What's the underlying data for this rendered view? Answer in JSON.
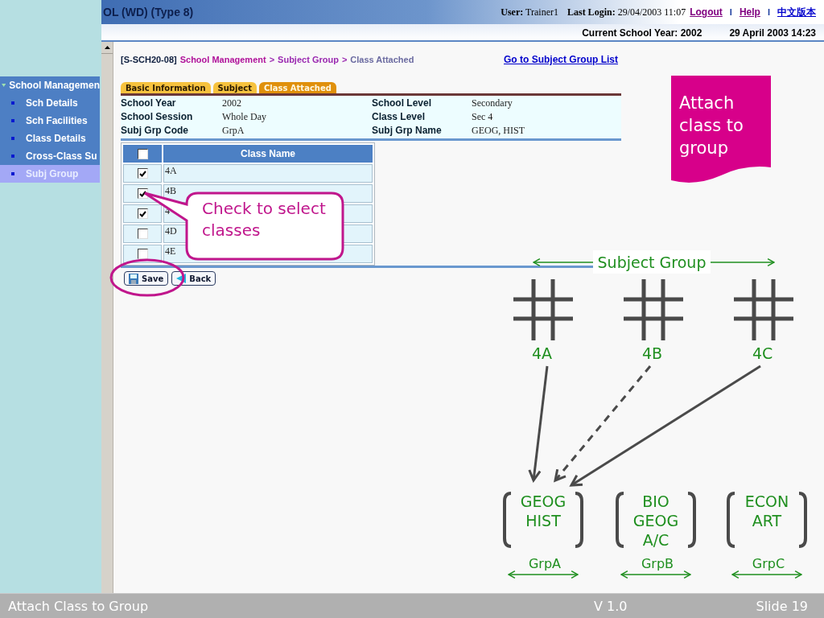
{
  "header": {
    "title": "OL (WD) (Type 8)",
    "user_label": "User:",
    "user": "Trainer1",
    "last_login_label": "Last Login:",
    "last_login": "29/04/2003 11:07",
    "links": [
      {
        "label": "Logout",
        "kind": "visited"
      },
      {
        "label": "Help",
        "kind": "visited"
      },
      {
        "label": "中文版本",
        "kind": "plain"
      }
    ],
    "separators": [
      "I",
      "I"
    ],
    "current_school_year": "Current School Year: 2002",
    "datetime": "29 April 2003 14:23"
  },
  "sidebar": {
    "items": [
      {
        "label": "School Managemen",
        "kind": "heading",
        "selected": false
      },
      {
        "label": "Sch Details",
        "kind": "item",
        "selected": false
      },
      {
        "label": "Sch Facilities",
        "kind": "item",
        "selected": false
      },
      {
        "label": "Class Details",
        "kind": "item",
        "selected": false
      },
      {
        "label": "Cross-Class Su",
        "kind": "item",
        "selected": false
      },
      {
        "label": "Subj Group",
        "kind": "item",
        "selected": true
      }
    ]
  },
  "breadcrumb": [
    {
      "text": "[S-SCH20-08]",
      "kind": "code"
    },
    {
      "text": "School Management",
      "kind": "link"
    },
    {
      "text": ">",
      "kind": "sep"
    },
    {
      "text": "Subject Group",
      "kind": "link2"
    },
    {
      "text": ">",
      "kind": "sep"
    },
    {
      "text": "Class Attached",
      "kind": "current"
    }
  ],
  "go_to_link": "Go to Subject Group List",
  "tabs": [
    {
      "label": "Basic Information",
      "selected": false
    },
    {
      "label": "Subject",
      "selected": false
    },
    {
      "label": "Class Attached",
      "selected": true
    }
  ],
  "fields": [
    {
      "label": "School Year",
      "value": "2002"
    },
    {
      "label": "School Level",
      "value": "Secondary"
    },
    {
      "label": "School Session",
      "value": "Whole Day"
    },
    {
      "label": "Class Level",
      "value": "Sec 4"
    },
    {
      "label": "Subj Grp Code",
      "value": "GrpA"
    },
    {
      "label": "Subj Grp Name",
      "value": "GEOG, HIST"
    }
  ],
  "class_table": {
    "select_all_checked": false,
    "column": "Class Name",
    "rows": [
      {
        "name": "4A",
        "checked": true
      },
      {
        "name": "4B",
        "checked": true
      },
      {
        "name": "4",
        "checked": true
      },
      {
        "name": "4D",
        "checked": false
      },
      {
        "name": "4E",
        "checked": false
      }
    ]
  },
  "buttons": [
    {
      "label": "Save",
      "kind": "save"
    },
    {
      "label": "Back",
      "kind": "back"
    }
  ],
  "callout": "Check to select classes",
  "banner": "Attach class to group",
  "diagram": {
    "title": "Subject Group",
    "classes": [
      {
        "label": "4A"
      },
      {
        "label": "4B"
      },
      {
        "label": "4C"
      }
    ],
    "groups": [
      {
        "subjects": [
          "GEOG",
          "HIST"
        ],
        "code": "GrpA"
      },
      {
        "subjects": [
          "BIO",
          "GEOG",
          "A/C"
        ],
        "code": "GrpB"
      },
      {
        "subjects": [
          "ECON",
          "ART"
        ],
        "code": "GrpC"
      }
    ],
    "links": [
      {
        "kind": "solid"
      },
      {
        "kind": "dashed"
      },
      {
        "kind": "solid"
      }
    ]
  },
  "footer": {
    "title": "Attach Class to Group",
    "version": "V 1.0",
    "slide": "Slide 19"
  }
}
